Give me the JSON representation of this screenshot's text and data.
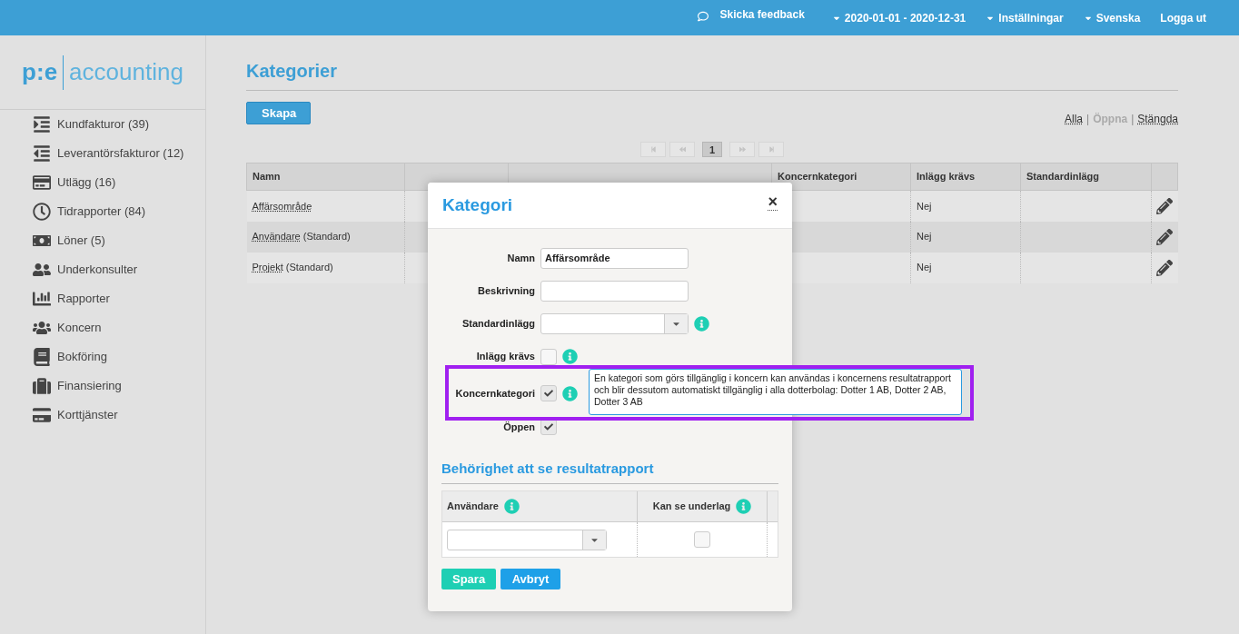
{
  "topbar": {
    "feedback": "Skicka feedback",
    "menus": [
      {
        "label": "2020-01-01 - 2020-12-31"
      },
      {
        "label": "Inställningar"
      },
      {
        "label": "Svenska"
      }
    ],
    "logout": "Logga ut"
  },
  "logo": {
    "brand": "p:e",
    "product": "accounting"
  },
  "sidebar": {
    "items": [
      {
        "label": "Kundfakturor (39)",
        "kind": "indent"
      },
      {
        "label": "Leverantörsfakturor (12)",
        "kind": "outdent"
      },
      {
        "label": "Utlägg (16)",
        "kind": "card"
      },
      {
        "label": "Tidrapporter (84)",
        "kind": "clock"
      },
      {
        "label": "Löner (5)",
        "kind": "money"
      },
      {
        "label": "Underkonsulter",
        "kind": "pair"
      },
      {
        "label": "Rapporter",
        "kind": "chart"
      },
      {
        "label": "Koncern",
        "kind": "group"
      },
      {
        "label": "Bokföring",
        "kind": "book"
      },
      {
        "label": "Finansiering",
        "kind": "suitcase"
      },
      {
        "label": "Korttjänster",
        "kind": "card2"
      }
    ]
  },
  "page": {
    "title": "Kategorier",
    "create_button": "Skapa",
    "filter_separator": "|",
    "filters": [
      {
        "label": "Alla",
        "selected": false
      },
      {
        "label": "Öppna",
        "selected": true
      },
      {
        "label": "Stängda",
        "selected": false
      }
    ]
  },
  "pagination": {
    "pages": [
      {
        "label": "1",
        "selected": true
      }
    ]
  },
  "table": {
    "columns": {
      "column_1": "Namn",
      "column_4": "Koncernkategori",
      "column_5": "Inlägg krävs",
      "column_6": "Standardinlägg"
    },
    "rows": [
      {
        "name": "Affärsområde",
        "required": "Nej"
      },
      {
        "name": "Användare",
        "suffix": "(Standard)",
        "required": "Nej"
      },
      {
        "name": "Projekt",
        "suffix": "(Standard)",
        "required": "Nej"
      }
    ]
  },
  "modal": {
    "title": "Kategori",
    "close": "×",
    "fields": [
      {
        "label": "Namn",
        "kind": "text",
        "value": "Affärsområde",
        "info": false
      },
      {
        "label": "Beskrivning",
        "kind": "text",
        "info": false
      },
      {
        "label": "Standardinlägg",
        "kind": "select",
        "info": true
      },
      {
        "label": "Inlägg krävs",
        "kind": "checkbox",
        "checked": false,
        "info": true
      },
      {
        "label": "Koncernkategori",
        "kind": "checkbox",
        "checked": true,
        "info": true,
        "tooltip": "En kategori som görs tillgänglig i koncern kan användas i koncernens resultatrapport och blir dessutom automatiskt tillgänglig i alla dotterbolag: Dotter 1 AB, Dotter 2 AB, Dotter 3 AB"
      },
      {
        "label": "Öppen",
        "kind": "checkbox",
        "checked": true,
        "info": false
      }
    ],
    "section_title": "Behörighet att se resultatrapport",
    "access_table": {
      "columns": [
        "Användare",
        "Kan se underlag"
      ],
      "rows": [
        {
          "can_see": false
        }
      ]
    },
    "buttons": [
      {
        "label": "Spara",
        "kind": "primary"
      },
      {
        "label": "Avbryt",
        "kind": "secondary"
      }
    ]
  }
}
